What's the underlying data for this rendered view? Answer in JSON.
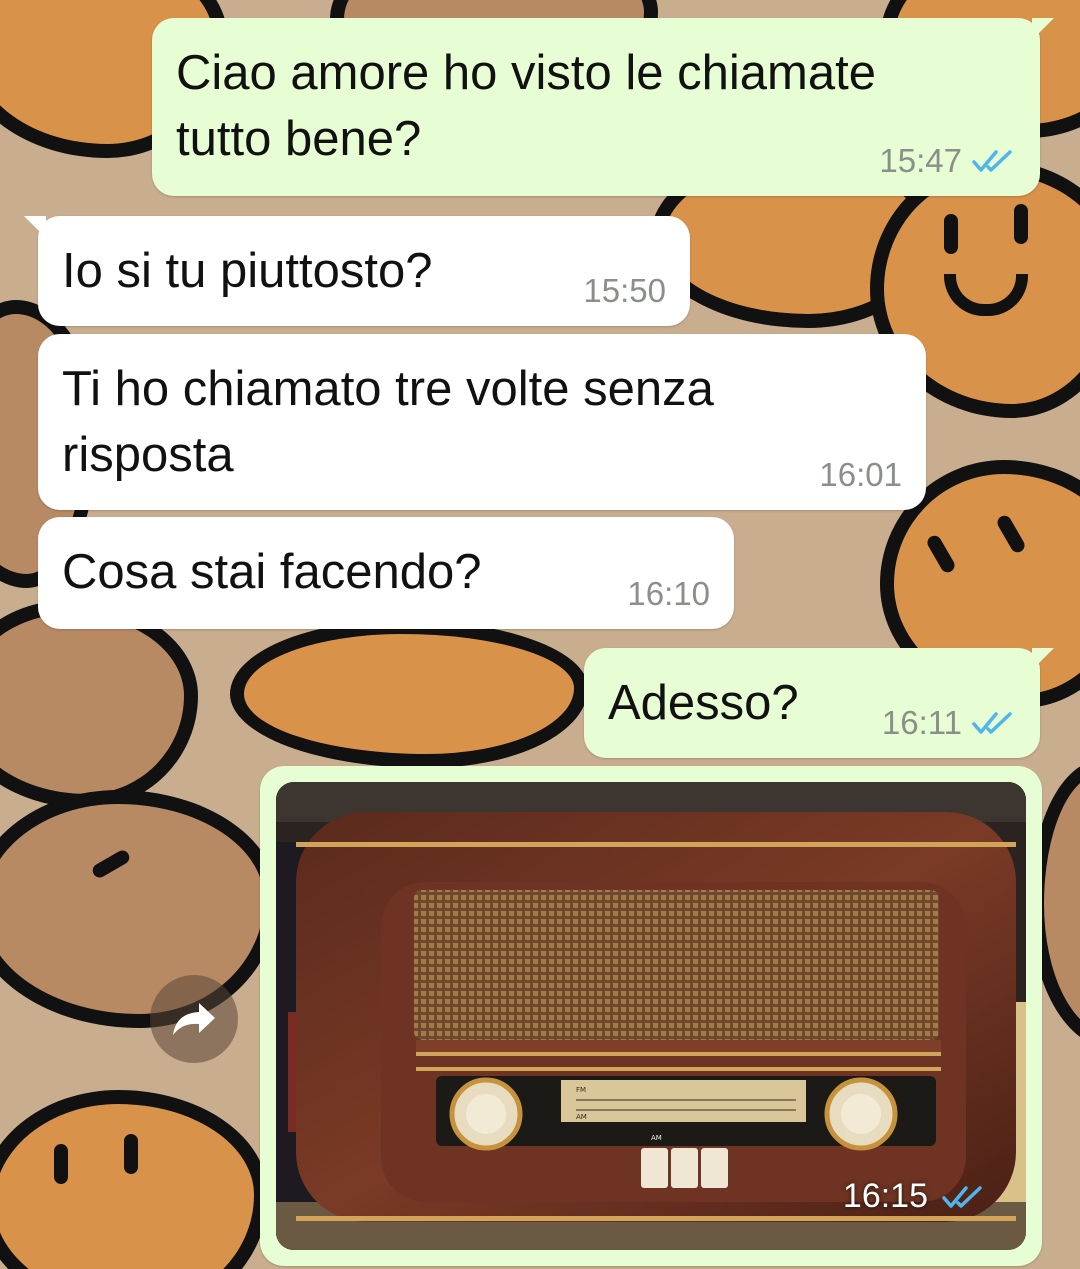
{
  "colors": {
    "incoming": "#ffffff",
    "outgoing": "#e7fdd3",
    "read_ticks": "#4fb6ec",
    "time": "#8a8f8a"
  },
  "messages": [
    {
      "text": "Ciao amore ho visto le chiamate\ntutto bene?",
      "time": "15:47",
      "direction": "outgoing",
      "status": "read"
    },
    {
      "text": "Io si tu piuttosto?",
      "time": "15:50",
      "direction": "incoming"
    },
    {
      "text": "Ti ho chiamato tre volte senza\nrisposta",
      "time": "16:01",
      "direction": "incoming"
    },
    {
      "text": "Cosa stai facendo?",
      "time": "16:10",
      "direction": "incoming"
    },
    {
      "text": "Adesso?",
      "time": "16:11",
      "direction": "outgoing",
      "status": "read"
    }
  ],
  "photo_message": {
    "time": "16:15",
    "status": "read",
    "image": "vintage wooden radio",
    "dial": {
      "row1": [
        "FM",
        "88",
        "96",
        "100",
        "104",
        "108",
        "MHz"
      ],
      "row2": [
        "AM",
        "530",
        "600",
        "700",
        "900",
        "1200",
        "1400",
        "1600",
        "KHz"
      ],
      "buttons": [
        "AM",
        "FM",
        "ON/OFF"
      ]
    }
  },
  "forward_icon": "forward-arrow-icon"
}
